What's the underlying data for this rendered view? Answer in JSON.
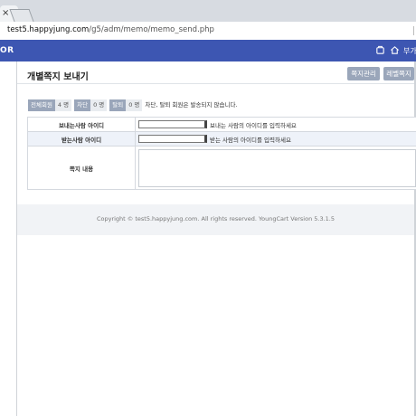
{
  "browser": {
    "tab_close": "×",
    "url_host": "test5.happyjung.com",
    "url_path": "/g5/adm/memo/memo_send.php"
  },
  "header": {
    "brand": "OR",
    "user_label": "부가",
    "icons": [
      "notification-icon",
      "home-icon"
    ]
  },
  "page": {
    "title": "개별쪽지 보내기",
    "buttons": [
      "쪽지관리",
      "레벨쪽지"
    ]
  },
  "stats": {
    "total_label": "전체회원",
    "total_value": "4 명",
    "blocked_label": "차단",
    "blocked_value": "0 명",
    "left_label": "탈퇴",
    "left_value": "0 명",
    "note": "차단, 탈퇴 회원은 발송되지 않습니다."
  },
  "form": {
    "sender_label": "보내는사람 아이디",
    "sender_hint": "보내는 사람의 아이디를 입력하세요",
    "receiver_label": "받는사람 아이디",
    "receiver_hint": "받는 사람의 아이디를 입력하세요",
    "content_label": "쪽지 내용"
  },
  "footer": {
    "copyright": "Copyright © test5.happyjung.com. All rights reserved. YoungCart Version 5.3.1.5"
  },
  "colors": {
    "header_bg": "#3d56b2",
    "button_bg": "#9aa6ba",
    "alt_row_bg": "#eef2f9"
  }
}
